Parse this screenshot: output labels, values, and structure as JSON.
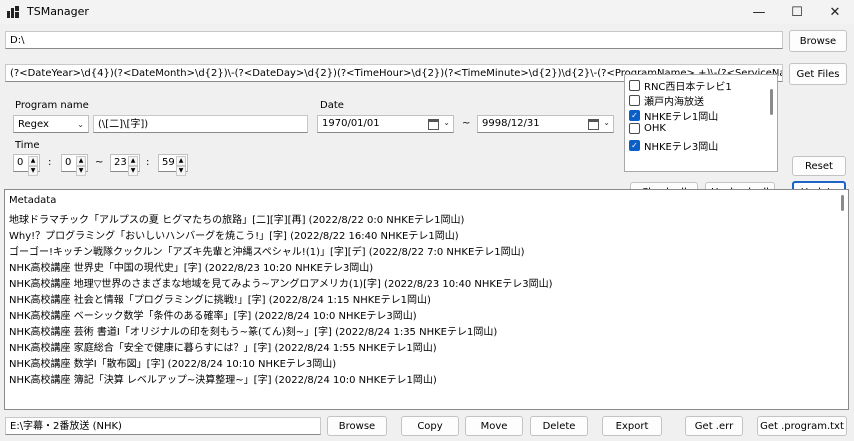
{
  "window": {
    "title": "TSManager",
    "minimize_icon": "—",
    "maximize_icon": "☐",
    "close_icon": "✕"
  },
  "path": {
    "value": "D:\\",
    "browse_label": "Browse"
  },
  "regex": {
    "value": "(?<DateYear>\\d{4})(?<DateMonth>\\d{2})\\-(?<DateDay>\\d{2})(?<TimeHour>\\d{2})(?<TimeMinute>\\d{2})\\d{2}\\-(?<ProgramName>.+)\\-(?<ServiceName>.+)\\.m2ts$",
    "get_files_label": "Get Files"
  },
  "program_filter": {
    "label": "Program name",
    "mode": "Regex",
    "pattern": "(\\[二]\\[字])"
  },
  "date_filter": {
    "label": "Date",
    "from": "1970/01/01",
    "to": "9998/12/31",
    "separator": "~"
  },
  "time_filter": {
    "label": "Time",
    "from_hour": "0",
    "from_minute": "0",
    "to_hour": "23",
    "to_minute": "59",
    "colon": ":",
    "separator": "~"
  },
  "services": [
    {
      "name": "RNC西日本テレビ1",
      "checked": false
    },
    {
      "name": "瀬戸内海放送",
      "checked": false
    },
    {
      "name": "NHKEテレ1岡山",
      "checked": true
    },
    {
      "name": "OHK",
      "checked": false
    },
    {
      "name": "NHKEテレ3岡山",
      "checked": true
    }
  ],
  "buttons": {
    "reset": "Reset",
    "check_all": "Check all",
    "uncheck_all": "Uncheck all",
    "update": "Update"
  },
  "metadata": {
    "header": "Metadata",
    "rows": [
      "地球ドラマチック「アルプスの夏 ヒグマたちの旅路」[二][字][再] (2022/8/22 0:0 NHKEテレ1岡山)",
      "Why!？プログラミング「おいしいハンバーグを焼こう!」[字] (2022/8/22 16:40 NHKEテレ1岡山)",
      "ゴーゴー!キッチン戦隊クックルン「アズキ先輩と沖縄スペシャル!(1)」[字][デ] (2022/8/22 7:0 NHKEテレ1岡山)",
      "NHK高校講座 世界史「中国の現代史」[字] (2022/8/23 10:20 NHKEテレ3岡山)",
      "NHK高校講座 地理▽世界のさまざまな地域を見てみよう~アングロアメリカ(1)[字] (2022/8/23 10:40 NHKEテレ3岡山)",
      "NHK高校講座 社会と情報「プログラミングに挑戦!」[字] (2022/8/24 1:15 NHKEテレ1岡山)",
      "NHK高校講座 ベーシック数学「条件のある確率」[字] (2022/8/24 10:0 NHKEテレ3岡山)",
      "NHK高校講座 芸術 書道I「オリジナルの印を刻もう~篆(てん)刻~」[字] (2022/8/24 1:35 NHKEテレ1岡山)",
      "NHK高校講座 家庭総合「安全で健康に暮らすには？」[字] (2022/8/24 1:55 NHKEテレ1岡山)",
      "NHK高校講座 数学I「散布図」[字] (2022/8/24 10:10 NHKEテレ3岡山)",
      "NHK高校講座 簿記「決算 レベルアップ~決算整理~」[字] (2022/8/24 10:0 NHKEテレ1岡山)"
    ]
  },
  "output": {
    "path": "E:\\字幕・2番放送 (NHK)",
    "browse": "Browse",
    "copy": "Copy",
    "move": "Move",
    "delete": "Delete",
    "export": "Export",
    "get_err": "Get .err",
    "get_program_txt": "Get .program.txt"
  },
  "accent_color": "#0a5fc7"
}
